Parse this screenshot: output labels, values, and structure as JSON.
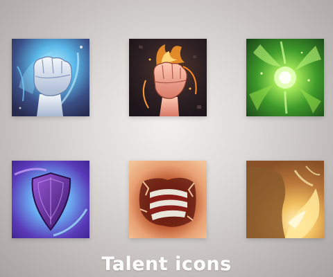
{
  "caption": "Talent icons",
  "icons": [
    {
      "name": "ice-fist-icon",
      "colors": {
        "bg": "#3a4a7a",
        "glow": "#8ad8ff",
        "skin": "#dde6f0"
      }
    },
    {
      "name": "fire-fist-icon",
      "colors": {
        "bg": "#2a1f22",
        "glow": "#ffb24a",
        "skin": "#f4a58f"
      }
    },
    {
      "name": "green-energy-orb-icon",
      "colors": {
        "bg": "#1f5a1f",
        "glow": "#b8f56a",
        "core": "#d9ffb0"
      }
    },
    {
      "name": "purple-shield-icon",
      "colors": {
        "bg": "#3a2a8a",
        "glow": "#7ad8ff",
        "shield": "#5a2a8a"
      }
    },
    {
      "name": "torn-flesh-wrapped-limb-icon",
      "colors": {
        "bg": "#e8a870",
        "wound": "#6a1a12",
        "wrap": "#e8e4dc"
      }
    },
    {
      "name": "golden-fire-burst-icon",
      "colors": {
        "bg": "#a86a30",
        "glow": "#ffe89a",
        "shadow": "#7a4a20"
      }
    }
  ]
}
